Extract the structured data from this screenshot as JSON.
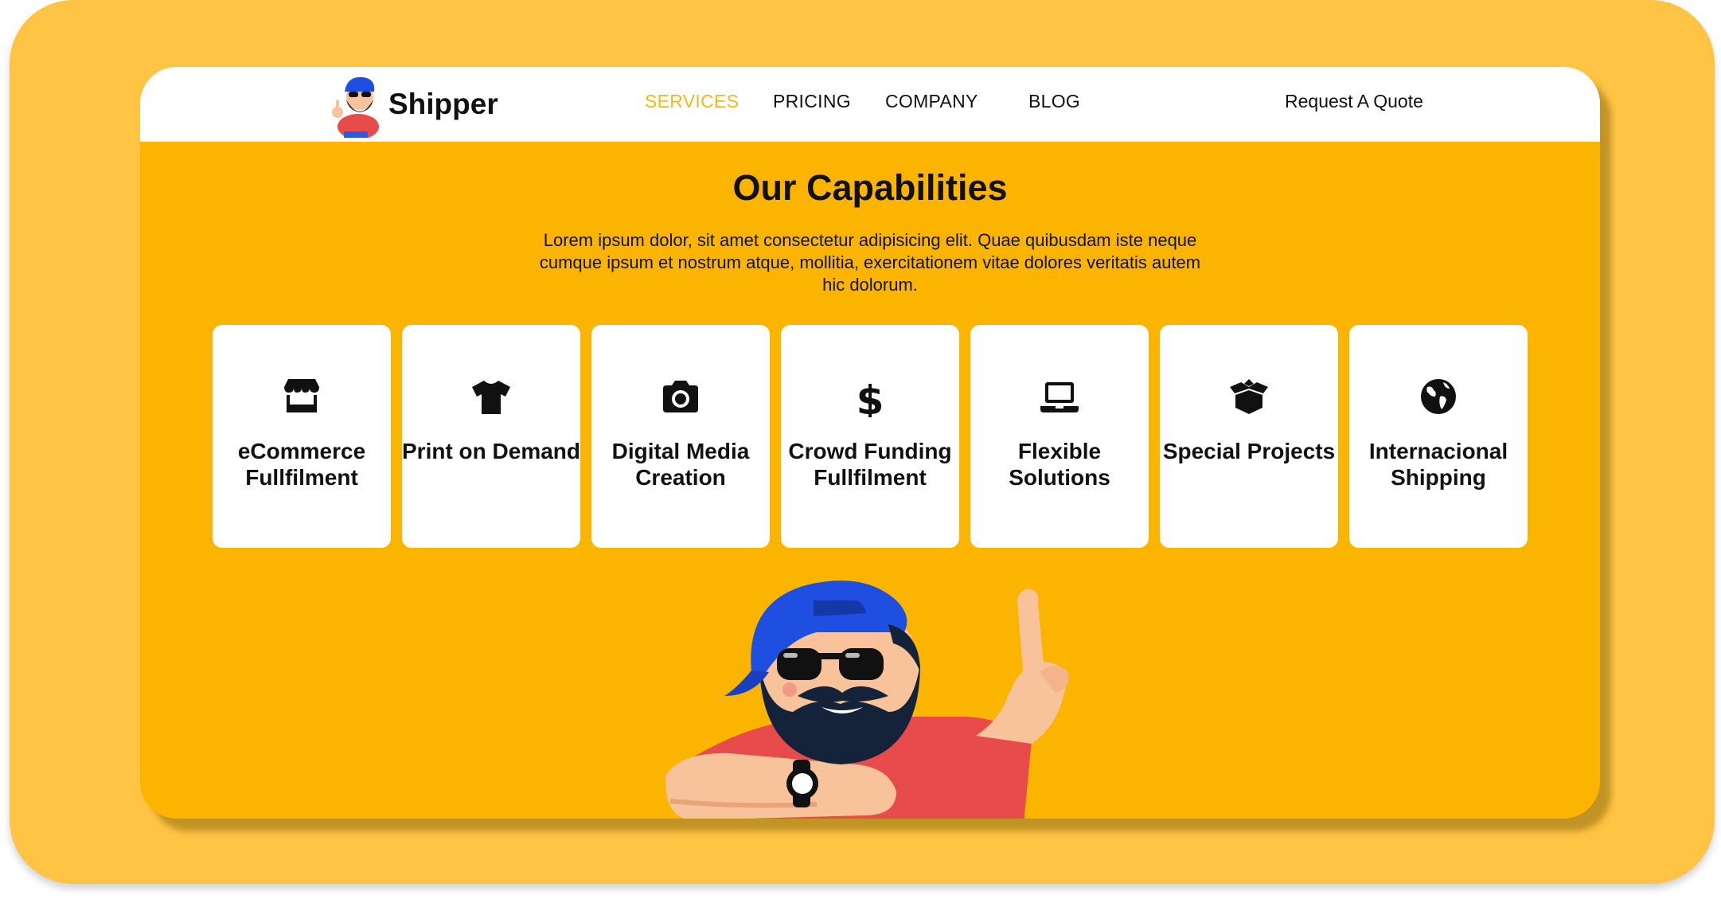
{
  "brand": {
    "name": "Shipper",
    "accent": "#fbb500",
    "active_link_color": "#f2b81c"
  },
  "nav": {
    "links": [
      {
        "label": "SERVICES",
        "active": true
      },
      {
        "label": "PRICING",
        "active": false
      },
      {
        "label": "COMPANY",
        "active": false
      },
      {
        "label": "BLOG",
        "active": false
      }
    ],
    "cta": "Request A Quote"
  },
  "capabilities": {
    "title": "Our Capabilities",
    "description": "Lorem ipsum dolor, sit amet consectetur adipisicing elit. Quae quibusdam iste neque cumque ipsum et nostrum atque, mollitia, exercitationem vitae dolores veritatis autem hic dolorum.",
    "cards": [
      {
        "title": "eCommerce Fullfilment",
        "icon": "store-icon"
      },
      {
        "title": "Print on Demand",
        "icon": "tshirt-icon"
      },
      {
        "title": "Digital Media Creation",
        "icon": "camera-icon"
      },
      {
        "title": "Crowd Funding Fullfilment",
        "icon": "dollar-icon"
      },
      {
        "title": "Flexible Solutions",
        "icon": "laptop-icon"
      },
      {
        "title": "Special Projects",
        "icon": "box-open-icon"
      },
      {
        "title": "Internacional Shipping",
        "icon": "globe-icon"
      }
    ]
  }
}
